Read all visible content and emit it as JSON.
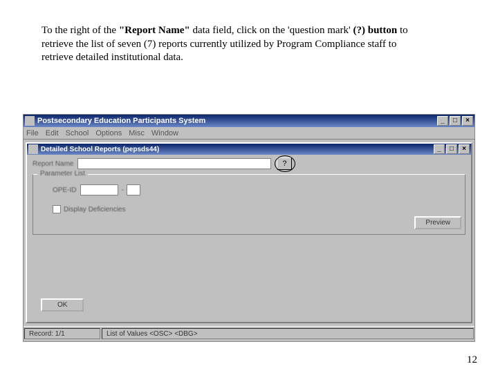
{
  "instruction": {
    "prefix": "To the right of the ",
    "bold1": "\"Report Name\"",
    "mid1": " data field, click on the 'question mark' ",
    "bold2": "(?) button",
    "rest": " to retrieve the list of seven (7) reports currently utilized by Program Compliance staff to retrieve detailed institutional data."
  },
  "page_number": "12",
  "outer_window": {
    "title": "Postsecondary Education Participants System",
    "controls": {
      "min": "_",
      "max": "□",
      "close": "×"
    }
  },
  "menubar": [
    "File",
    "Edit",
    "School",
    "Options",
    "Misc",
    "Window"
  ],
  "inner_window": {
    "title": "Detailed School Reports (pepsds44)",
    "controls": {
      "min": "_",
      "max": "□",
      "close": "×"
    }
  },
  "form": {
    "report_name_label": "Report Name",
    "question_mark_label": "?",
    "parameter_list_legend": "Parameter List",
    "ope_id_label": "OPE-ID",
    "dash_label": "-",
    "display_deficiencies_label": "Display Deficiencies",
    "preview_button": "Preview",
    "ok_button": "OK"
  },
  "statusbar": {
    "record": "Record: 1/1",
    "hint": "List of Values  <OSC>  <DBG>"
  }
}
